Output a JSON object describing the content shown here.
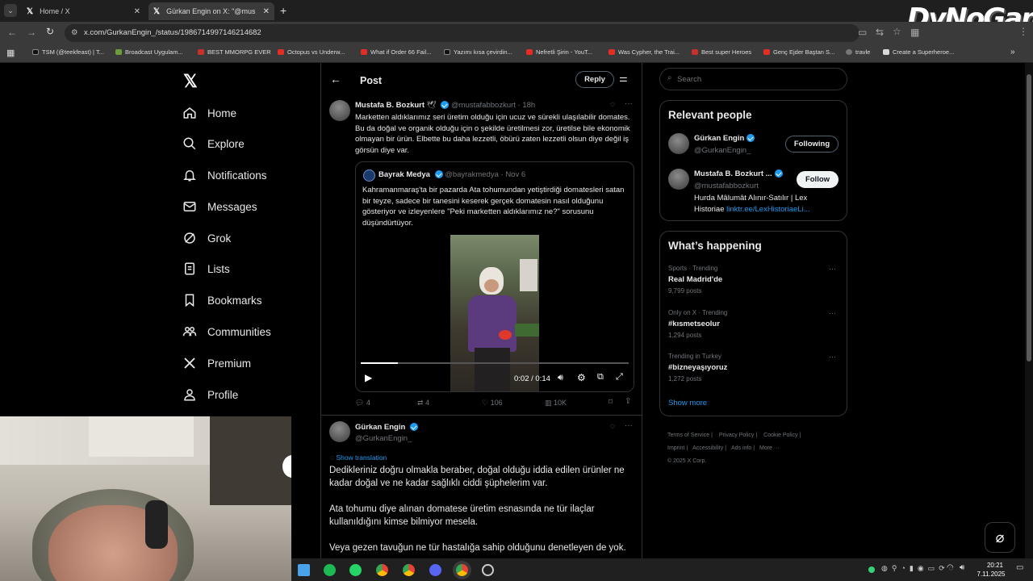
{
  "browser": {
    "tabs": [
      {
        "label": "Home / X"
      },
      {
        "label": "Gürkan Engin on X: \"@mustafal"
      }
    ],
    "url_main": "x.com/GurkanEngin_/status/1986714997146214682",
    "bookmarks": [
      {
        "label": "TSM (@teekfeast) | T..."
      },
      {
        "label": "Broadcast Uygulam..."
      },
      {
        "label": "BEST MMORPG EVER"
      },
      {
        "label": "Octopus vs Underw..."
      },
      {
        "label": "What if Order 66 Fail..."
      },
      {
        "label": "Yazımı kısa çevirdin..."
      },
      {
        "label": "Nefretli Şirin - YouT..."
      },
      {
        "label": "Was Cypher, the Trai..."
      },
      {
        "label": "Best super Heroes"
      },
      {
        "label": "Genç Ejder Baştan S..."
      },
      {
        "label": "travle"
      },
      {
        "label": "Create a Superheroe..."
      }
    ],
    "watermark": "DyNoGame"
  },
  "sidebar": {
    "items": [
      {
        "label": "Home",
        "icon": "home-icon"
      },
      {
        "label": "Explore",
        "icon": "search-icon"
      },
      {
        "label": "Notifications",
        "icon": "bell-icon"
      },
      {
        "label": "Messages",
        "icon": "mail-icon"
      },
      {
        "label": "Grok",
        "icon": "grok-icon"
      },
      {
        "label": "Lists",
        "icon": "list-icon"
      },
      {
        "label": "Bookmarks",
        "icon": "bookmark-icon"
      },
      {
        "label": "Communities",
        "icon": "people-icon"
      },
      {
        "label": "Premium",
        "icon": "x-icon"
      },
      {
        "label": "Profile",
        "icon": "person-icon"
      }
    ]
  },
  "header": {
    "title": "Post",
    "reply": "Reply"
  },
  "post": {
    "name": "Mustafa B. Bozkurt",
    "handle": "@mustafabbozkurt",
    "time": "18h",
    "text": "Marketten aldıklarımız seri üretim olduğu için ucuz ve sürekli ulaşılabilir domates. Bu da doğal ve organik olduğu için o şekilde üretilmesi zor, üretilse bile ekonomik olmayan bir ürün. Elbette bu daha lezzetli, öbürü zaten lezzetli olsun diye değil iş görsün diye var.",
    "quote": {
      "name": "Bayrak Medya",
      "handle": "@bayrakmedya",
      "time": "Nov 6",
      "text": "Kahramanmaraş'ta bir pazarda Ata tohumundan yetiştirdiği domatesleri satan bir teyze, sadece bir tanesini keserek gerçek domatesin nasıl olduğunu gösteriyor ve izleyenlere \"Peki marketten aldıklarımız ne?\" sorusunu düşündürtüyor."
    },
    "video": {
      "time": "0:02 / 0:14",
      "progress": 0.14
    },
    "stats": {
      "replies": "4",
      "reposts": "4",
      "likes": "106",
      "views": "10K"
    }
  },
  "reply": {
    "name": "Gürkan Engin",
    "handle": "@GurkanEngin_",
    "translate": "Show translation",
    "p1": "Dedikleriniz doğru olmakla beraber, doğal olduğu iddia edilen ürünler ne kadar doğal ve ne kadar sağlıklı ciddi şüphelerim var.",
    "p2": "Ata tohumu diye alınan domatese üretim esnasında ne tür ilaçlar kullanıldığını kimse bilmiyor mesela.",
    "p3": "Veya gezen tavuğun ne tür hastalığa sahip olduğunu denetleyen de yok."
  },
  "search": {
    "placeholder": "Search"
  },
  "relevant": {
    "title": "Relevant people",
    "people": [
      {
        "name": "Gürkan Engin",
        "handle": "@GurkanEngin_",
        "button": "Following"
      },
      {
        "name": "Mustafa B. Bozkurt ...",
        "handle": "@mustafabbozkurt",
        "button": "Follow",
        "bio": "Hurda Mâlumât Alınır-Satılır | Lex Historiae ",
        "link": "linktr.ee/LexHistoriaeLi..."
      }
    ]
  },
  "trends": {
    "title": "What’s happening",
    "items": [
      {
        "context": "Sports · Trending",
        "name": "Real Madrid'de",
        "posts": "9,799 posts"
      },
      {
        "context": "Only on X · Trending",
        "name": "#kısmetseolur",
        "posts": "1,294 posts"
      },
      {
        "context": "Trending in Turkey",
        "name": "#bizneyaşıyoruz",
        "posts": "1,272 posts"
      }
    ],
    "more": "Show more"
  },
  "footer": {
    "links": [
      "Terms of Service",
      "Privacy Policy",
      "Cookie Policy",
      "Imprint",
      "Accessibility",
      "Ads info",
      "More ···"
    ],
    "copy": "© 2025 X Corp."
  },
  "taskbar": {
    "time": "20:21",
    "date": "7.11.2025"
  }
}
